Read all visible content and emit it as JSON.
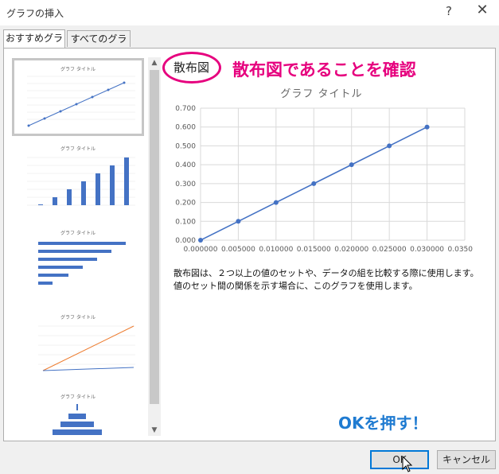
{
  "window": {
    "title": "グラフの挿入",
    "help": "?",
    "close": "✕"
  },
  "tabs": [
    {
      "label": "おすすめグラフ",
      "active": true
    },
    {
      "label": "すべてのグラフ",
      "active": false
    }
  ],
  "thumbnails": [
    {
      "title": "グラフ タイトル",
      "kind": "scatter"
    },
    {
      "title": "グラフ タイトル",
      "kind": "column"
    },
    {
      "title": "グラフ タイトル",
      "kind": "bar"
    },
    {
      "title": "グラフ タイトル",
      "kind": "line"
    },
    {
      "title": "グラフ タイトル",
      "kind": "funnel"
    }
  ],
  "chart_type_label": "散布図",
  "annotation_confirm": "散布図であることを確認",
  "description": "散布図は、２つ以上の値のセットや、データの組を比較する際に使用します。値のセット間の関係を示す場合に、このグラフを使用します。",
  "annotation_ok": "OKを押す！",
  "buttons": {
    "ok": "OK",
    "cancel": "キャンセル"
  },
  "colors": {
    "series": "#4472c4",
    "accent_pink": "#e6007e",
    "accent_blue": "#1f7bd1"
  },
  "chart_data": {
    "type": "scatter",
    "title": "グラフ タイトル",
    "x": [
      0,
      0.005,
      0.01,
      0.015,
      0.02,
      0.025,
      0.03
    ],
    "y": [
      0,
      0.1,
      0.2,
      0.3,
      0.4,
      0.5,
      0.6
    ],
    "xlim": [
      0,
      0.035
    ],
    "ylim": [
      0,
      0.7
    ],
    "xticks": [
      "0.000000",
      "0.005000",
      "0.010000",
      "0.015000",
      "0.020000",
      "0.025000",
      "0.030000",
      "0.035000"
    ],
    "yticks": [
      "0.000",
      "0.100",
      "0.200",
      "0.300",
      "0.400",
      "0.500",
      "0.600",
      "0.700"
    ],
    "grid": true,
    "legend": "none"
  }
}
